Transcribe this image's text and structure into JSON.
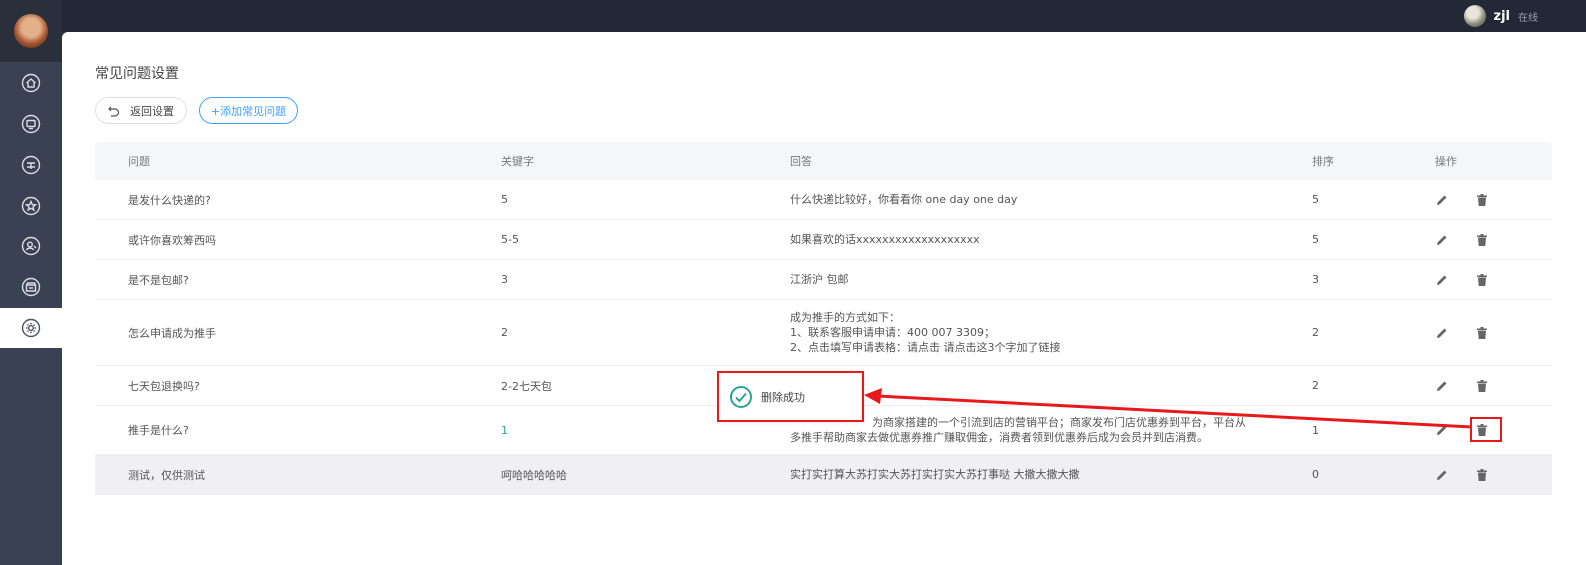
{
  "topbar": {
    "user_name": "zjl",
    "user_status": "在线"
  },
  "sidebar": {
    "items": [
      "home-icon",
      "monitor-icon",
      "finance-icon",
      "star-icon",
      "user-icon",
      "shop-icon",
      "settings-icon"
    ],
    "active_index": 6
  },
  "page": {
    "title": "常见问题设置"
  },
  "toolbar": {
    "back_label": "返回设置",
    "add_label": "+添加常见问题"
  },
  "table": {
    "headers": {
      "question": "问题",
      "keyword": "关键字",
      "answer": "回答",
      "sort": "排序",
      "action": "操作"
    },
    "rows": [
      {
        "question": "是发什么快递的?",
        "keyword": "5",
        "answer": [
          "什么快递比较好，你看看你 one day one day"
        ],
        "sort": "5"
      },
      {
        "question": "或许你喜欢筹西吗",
        "keyword": "5-5",
        "answer": [
          "如果喜欢的话xxxxxxxxxxxxxxxxxxx"
        ],
        "sort": "5"
      },
      {
        "question": "是不是包邮?",
        "keyword": "3",
        "answer": [
          "江浙沪 包邮"
        ],
        "sort": "3"
      },
      {
        "question": "怎么申请成为推手",
        "keyword": "2",
        "answer": [
          "成为推手的方式如下：",
          "1、联系客服申请申请：400 007 3309；",
          "2、点击填写申请表格：请点击       请点击这3个字加了链接"
        ],
        "sort": "2"
      },
      {
        "question": "七天包退换吗?",
        "keyword": "2-2七天包",
        "answer": [
          ""
        ],
        "sort": "2"
      },
      {
        "question": "推手是什么?",
        "keyword": "1",
        "answer": [
          "为商家搭建的一个引流到店的营销平台；商家发布门店优惠券到平台，平台从",
          "多推手帮助商家去做优惠券推广赚取佣金，消费者领到优惠券后成为会员并到店消费。"
        ],
        "sort": "1"
      },
      {
        "question": "测试，仅供测试",
        "keyword": "呵哈哈哈哈哈",
        "answer": [
          "实打实打算大苏打实大苏打实打实大苏打事哒 大撒大撒大撒"
        ],
        "sort": "0"
      }
    ]
  },
  "toast": {
    "message": "删除成功"
  },
  "colors": {
    "primary": "#409eff",
    "success": "#2aa590",
    "highlight": "#e8191b",
    "sidebar": "#3a4152",
    "topbar": "#222835"
  }
}
